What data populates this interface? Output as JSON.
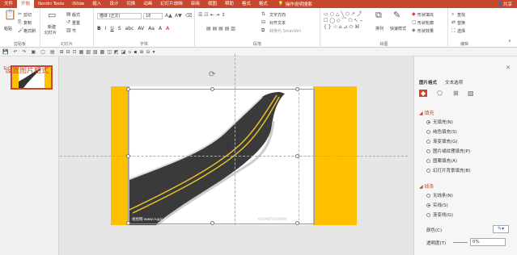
{
  "menubar": {
    "tabs": [
      "文件",
      "开始",
      "Nordri Tools",
      "iSlide",
      "插入",
      "设计",
      "切换",
      "动画",
      "幻灯片放映",
      "审阅",
      "视图",
      "帮助",
      "格式",
      "格式"
    ],
    "active_index": 1,
    "search": "操作说明搜索",
    "share": "共享"
  },
  "ribbon": {
    "clipboard": {
      "paste": "粘贴",
      "cut": "剪切",
      "copy": "复制",
      "format_painter": "格式刷",
      "label": "剪贴板"
    },
    "slides": {
      "new": "新建",
      "new2": "幻灯片",
      "layout": "版式",
      "reset": "重置",
      "section": "节",
      "label": "幻灯片"
    },
    "font": {
      "name": "楷体 (正文)",
      "size": "18",
      "label": "字体",
      "buttons": [
        "B",
        "I",
        "U",
        "S",
        "abc",
        "AV",
        "Aa",
        "A",
        "A"
      ]
    },
    "paragraph": {
      "text_direction": "文字方向",
      "align_text": "对齐文本",
      "smartart": "转换为 SmartArt",
      "label": "段落"
    },
    "drawing": {
      "arrange": "排列",
      "quick_styles": "快速样式",
      "fill": "形状填充",
      "outline": "形状轮廓",
      "effects": "形状效果",
      "label": "绘图"
    },
    "editing": {
      "find": "查找",
      "replace": "替换",
      "select": "选择",
      "label": "编辑"
    }
  },
  "thumbs": {
    "slide_number": "1"
  },
  "slide": {
    "watermark_left": "视觉网 www.rupic.com",
    "watermark_right": "YOUPHOTOGRAPH"
  },
  "panel": {
    "title": "设置图片格式",
    "tabs": [
      "图片格式",
      "文本选项"
    ],
    "fill_header": "填充",
    "fill_options": [
      "无填充(N)",
      "纯色填充(S)",
      "渐变填充(G)",
      "图片或纹理填充(P)",
      "图案填充(A)",
      "幻灯片背景填充(B)"
    ],
    "fill_selected": 0,
    "line_header": "线条",
    "line_options": [
      "无线条(N)",
      "实线(S)",
      "渐变线(G)"
    ],
    "line_selected": 1,
    "color_label": "颜色(C)",
    "transparency_label": "透明度(T)",
    "transparency_value": "0%"
  },
  "colors": {
    "accent": "#c7472e",
    "yellow": "#ffc000"
  }
}
